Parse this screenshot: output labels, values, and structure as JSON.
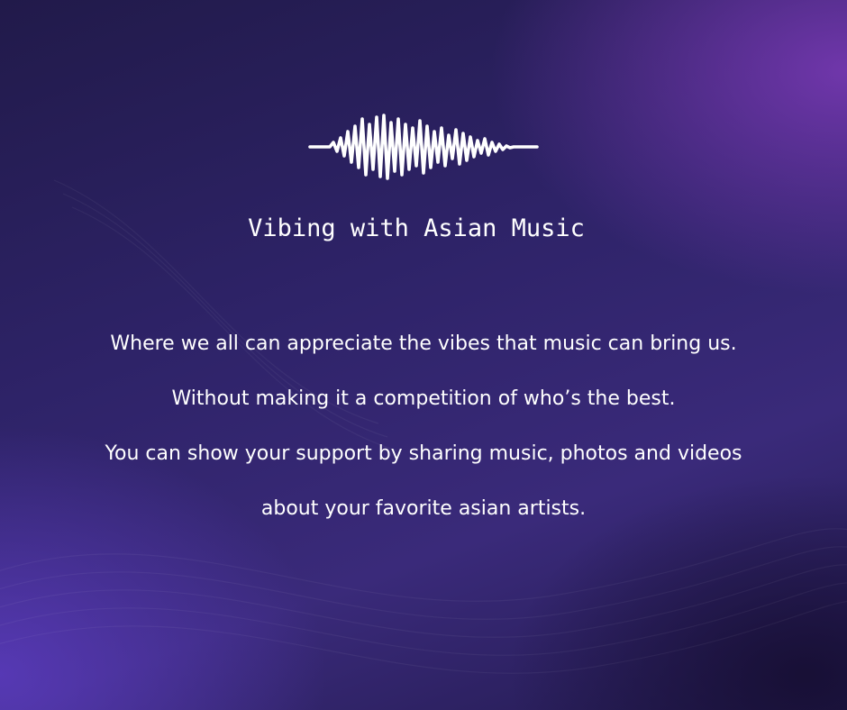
{
  "title": "Vibing with Asian Music",
  "body_lines": [
    "Where we all can appreciate the vibes that music can bring us.",
    "Without making it a competition of who’s the best.",
    "You can show your support by sharing music, photos and videos",
    "about your favorite asian artists."
  ],
  "icon": "sound-wave-icon",
  "colors": {
    "background_dark": "#211a4a",
    "background_mid": "#3a2a7a",
    "accent_purple": "#7c3ab7",
    "text": "#ffffff"
  }
}
